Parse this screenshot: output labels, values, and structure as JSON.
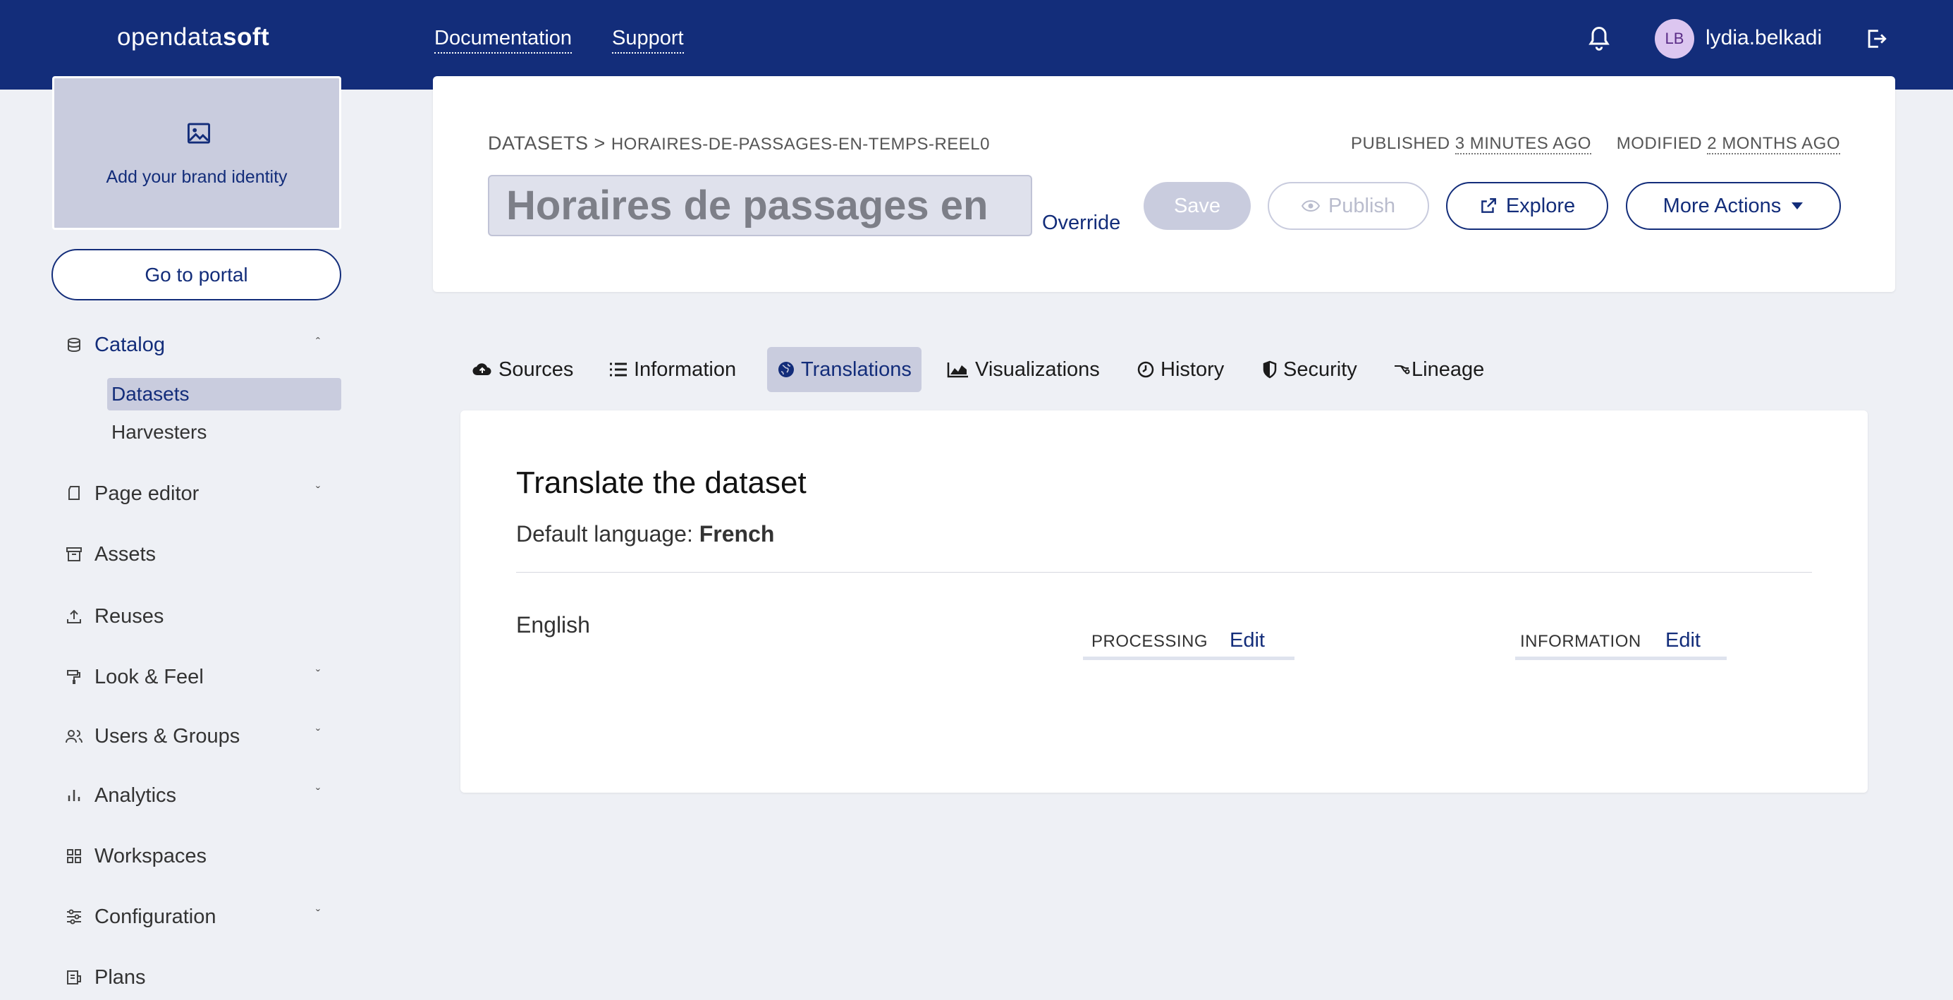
{
  "topbar": {
    "logo_light": "opendata",
    "logo_bold": "soft",
    "links": [
      "Documentation",
      "Support"
    ],
    "avatar_initials": "LB",
    "username": "lydia.belkadi",
    "colors": {
      "bar": "#132d7a"
    }
  },
  "sidebar": {
    "brand_text": "Add your brand identity",
    "portal_button": "Go to portal",
    "items": [
      {
        "label": "Catalog",
        "icon": "database-icon",
        "chevron": "up"
      },
      {
        "label": "Page editor",
        "icon": "page-icon",
        "chevron": "down"
      },
      {
        "label": "Assets",
        "icon": "archive-icon"
      },
      {
        "label": "Reuses",
        "icon": "upload-icon"
      },
      {
        "label": "Look & Feel",
        "icon": "paint-roller-icon",
        "chevron": "down"
      },
      {
        "label": "Users & Groups",
        "icon": "users-icon",
        "chevron": "down"
      },
      {
        "label": "Analytics",
        "icon": "bar-chart-icon",
        "chevron": "down"
      },
      {
        "label": "Workspaces",
        "icon": "grid-icon"
      },
      {
        "label": "Configuration",
        "icon": "sliders-icon",
        "chevron": "down"
      },
      {
        "label": "Plans",
        "icon": "plan-icon"
      }
    ],
    "subitems": [
      "Datasets",
      "Harvesters"
    ]
  },
  "header": {
    "breadcrumb_root": "DATASETS",
    "breadcrumb_sep": ">",
    "breadcrumb_current": "HORAIRES-DE-PASSAGES-EN-TEMPS-REEL0",
    "published_label": "PUBLISHED",
    "published_value": "3 MINUTES AGO",
    "modified_label": "MODIFIED",
    "modified_value": "2 MONTHS AGO",
    "title_value": "Horaires de passages en",
    "override": "Override",
    "buttons": {
      "save": "Save",
      "publish": "Publish",
      "explore": "Explore",
      "more": "More Actions"
    }
  },
  "tabs": [
    "Sources",
    "Information",
    "Translations",
    "Visualizations",
    "History",
    "Security",
    "Lineage"
  ],
  "content": {
    "title": "Translate the dataset",
    "default_language_label": "Default language:",
    "default_language_value": "French",
    "language": "English",
    "blocks": [
      {
        "label": "PROCESSING",
        "action": "Edit"
      },
      {
        "label": "INFORMATION",
        "action": "Edit"
      }
    ]
  }
}
